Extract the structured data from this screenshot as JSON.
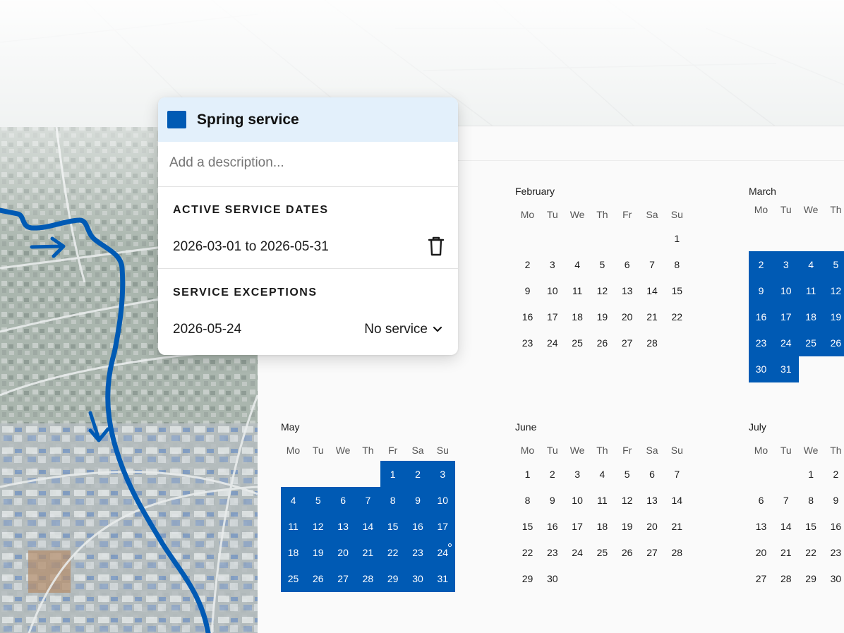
{
  "card": {
    "title": "Spring service",
    "color": "#005ab4",
    "description_placeholder": "Add a description...",
    "active_dates_label": "ACTIVE SERVICE DATES",
    "active_range": "2026-03-01 to 2026-05-31",
    "exceptions_label": "SERVICE EXCEPTIONS",
    "exception_date": "2026-05-24",
    "exception_type": "No service",
    "icons": {
      "delete": "trash-icon",
      "dropdown": "chevron-down-icon"
    }
  },
  "calendar": {
    "weekdays": [
      "Mo",
      "Tu",
      "We",
      "Th",
      "Fr",
      "Sa",
      "Su"
    ],
    "active_color": "#005ab4",
    "months": [
      {
        "name": "February",
        "start": 6,
        "days": 28,
        "active_from": null,
        "active_to": null,
        "visible_cols": 7
      },
      {
        "name": "March",
        "start": 6,
        "days": 31,
        "active_from": 1,
        "active_to": 31,
        "visible_cols": 4
      },
      {
        "name": "May",
        "start": 4,
        "days": 31,
        "active_from": 1,
        "active_to": 31,
        "visible_cols": 7,
        "exception_day": 24
      },
      {
        "name": "June",
        "start": 0,
        "days": 30,
        "active_from": null,
        "active_to": null,
        "visible_cols": 7
      },
      {
        "name": "July",
        "start": 2,
        "days": 31,
        "active_from": null,
        "active_to": null,
        "visible_cols": 4
      }
    ]
  }
}
